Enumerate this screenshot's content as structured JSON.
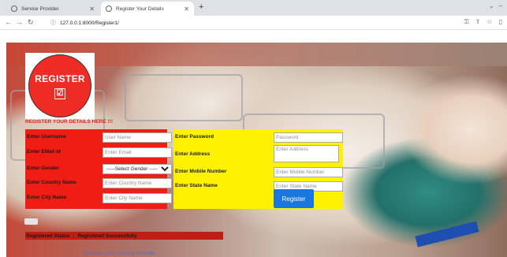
{
  "browser": {
    "tabs": [
      {
        "title": "Service Provider",
        "active": false
      },
      {
        "title": "Register Your Details",
        "active": true
      }
    ],
    "new_tab_symbol": "+",
    "url": "127.0.0.1:8000/Register1/"
  },
  "logo": {
    "text": "REGISTER",
    "check_symbol": "☑"
  },
  "heading": "REGISTER YOUR DETAILS HERE !!!",
  "form": {
    "left": [
      {
        "label": "Enter Username",
        "placeholder": "User Name"
      },
      {
        "label": "Enter EMail Id",
        "placeholder": "Enter Email"
      },
      {
        "label": "Enter Gender",
        "selected": "-----Select Gender -----"
      },
      {
        "label": "Enter Country Name",
        "placeholder": "Enter Country Name"
      },
      {
        "label": "Enter City Name",
        "placeholder": "Enter City Name"
      }
    ],
    "right": [
      {
        "label": "Enter Password",
        "placeholder": "Password"
      },
      {
        "label": "Enter Address",
        "placeholder": "Enter Address"
      },
      {
        "label": "Enter Mobile Number",
        "placeholder": "Enter Mobile Number"
      },
      {
        "label": "Enter State Name",
        "placeholder": "Enter State Name"
      }
    ],
    "submit_label": "Register"
  },
  "status": {
    "label": "Registered Status",
    "value": "Registered Successfully"
  },
  "footer": {
    "link1": "Remote User",
    "separator": "|",
    "link2": "Service Provider"
  },
  "colors": {
    "left_panel": "#f01d14",
    "right_panel": "#fff200",
    "button": "#1a77e0",
    "status_bar": "#c01d13"
  }
}
